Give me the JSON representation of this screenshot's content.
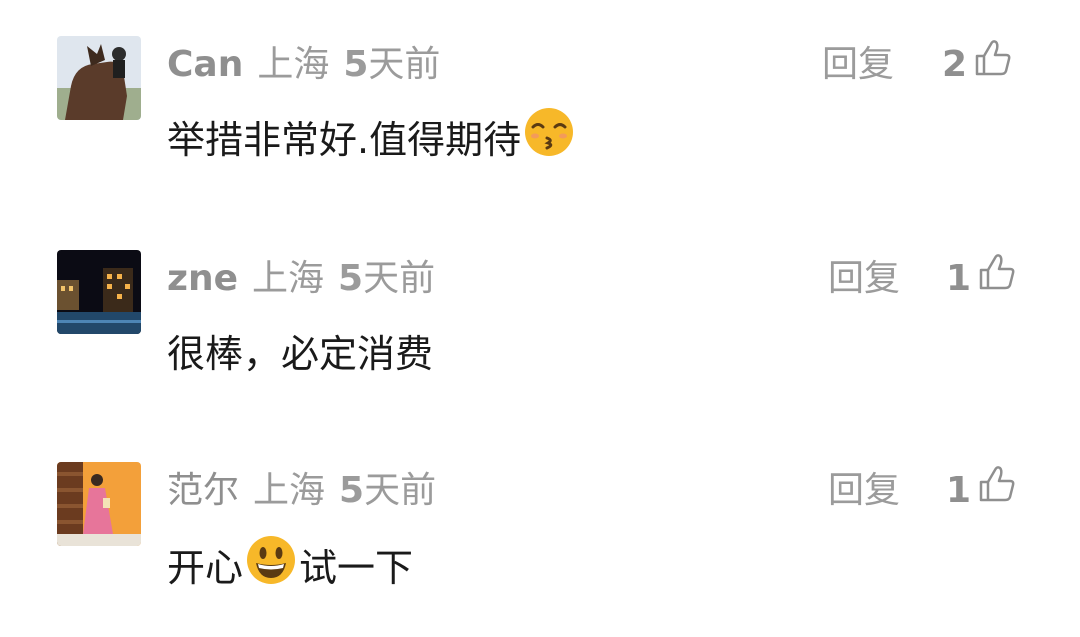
{
  "comments": [
    {
      "user": "Can",
      "location": "上海",
      "time_num": "5",
      "time_unit": "天前",
      "reply_label": "回复",
      "likes": "2",
      "text_before": "举措非常好.值得期待",
      "emoji": "kissing-face-with-closed-eyes",
      "text_after": ""
    },
    {
      "user": "zne",
      "location": "上海",
      "time_num": "5",
      "time_unit": "天前",
      "reply_label": "回复",
      "likes": "1",
      "text_before": "很棒，必定消费",
      "emoji": "",
      "text_after": ""
    },
    {
      "user": "范尔",
      "location": "上海",
      "time_num": "5",
      "time_unit": "天前",
      "reply_label": "回复",
      "likes": "1",
      "text_before": "开心",
      "emoji": "grinning-face",
      "text_after": "试一下"
    }
  ],
  "colors": {
    "meta_gray": "#9b9b9b",
    "text_dark": "#1a1a1a",
    "emoji_yellow": "#f7b829"
  }
}
